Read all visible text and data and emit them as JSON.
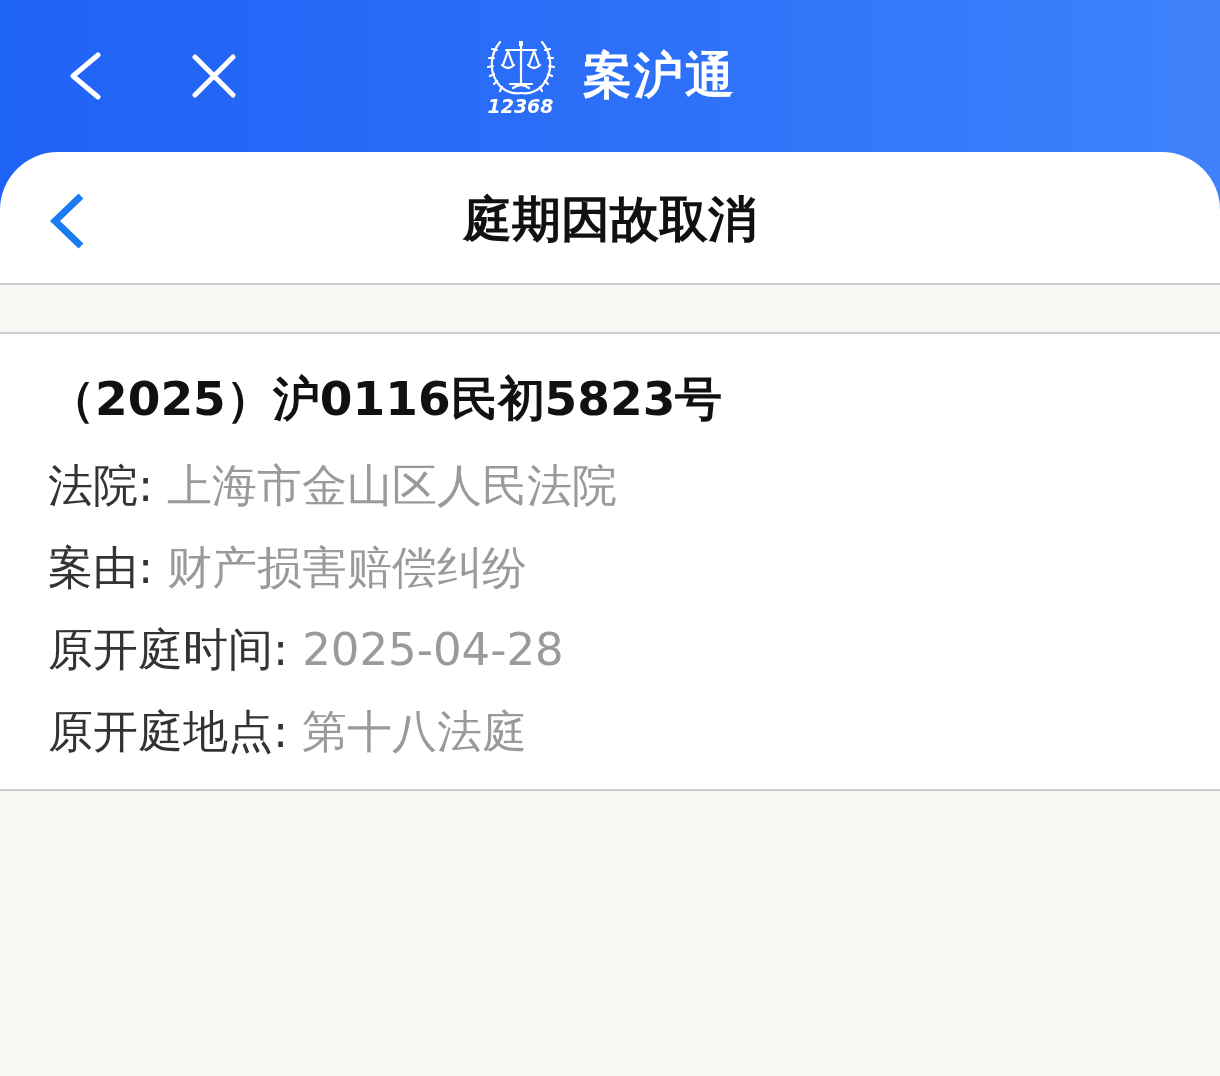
{
  "app_bar": {
    "logo_number": "12368",
    "title": "案沪通"
  },
  "page_header": {
    "title": "庭期因故取消"
  },
  "case": {
    "number": "（2025）沪0116民初5823号",
    "fields": [
      {
        "label": "法院:",
        "value": "上海市金山区人民法院"
      },
      {
        "label": "案由:",
        "value": "财产损害赔偿纠纷"
      },
      {
        "label": "原开庭时间:",
        "value": "2025-04-28"
      },
      {
        "label": "原开庭地点:",
        "value": "第十八法庭"
      }
    ]
  }
}
